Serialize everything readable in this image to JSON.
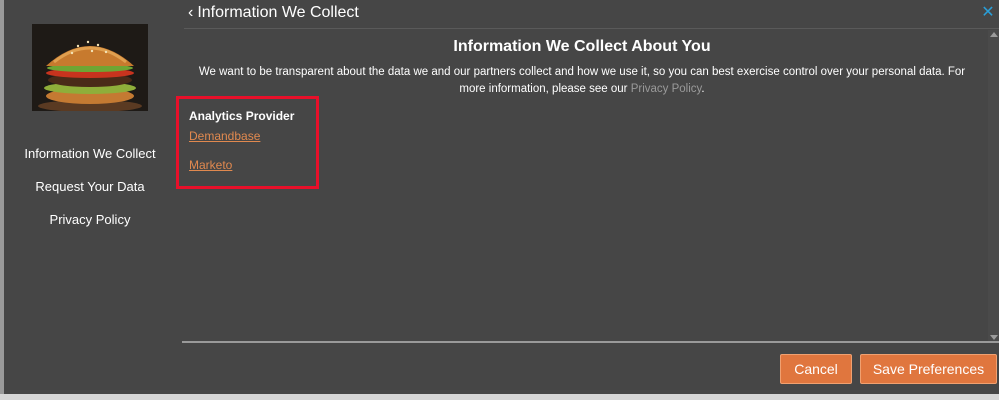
{
  "header": {
    "back_label": "Information We Collect",
    "back_icon": "chevron-left-icon",
    "close_icon": "close-icon",
    "close_color": "#2a9fd8"
  },
  "sidebar": {
    "logo": "burger-image",
    "items": [
      {
        "label": "Information We Collect"
      },
      {
        "label": "Request Your Data"
      },
      {
        "label": "Privacy Policy"
      }
    ]
  },
  "main": {
    "title": "Information We Collect About You",
    "description_before": "We want to be transparent about the data we and our partners collect and how we use it, so you can best exercise control over your personal data. For more information, please see our ",
    "privacy_link": "Privacy Policy",
    "description_after": ".",
    "provider_category": "Analytics Provider",
    "providers": [
      {
        "name": "Demandbase"
      },
      {
        "name": "Marketo"
      }
    ]
  },
  "footer": {
    "cancel_label": "Cancel",
    "save_label": "Save Preferences",
    "accent": "#e0763e"
  }
}
